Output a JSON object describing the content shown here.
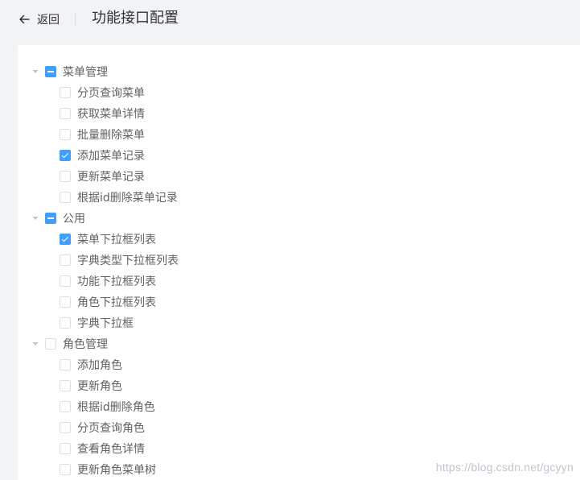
{
  "header": {
    "back_label": "返回",
    "title": "功能接口配置"
  },
  "tree": [
    {
      "label": "菜单管理",
      "state": "indeterminate",
      "expanded": true,
      "children": [
        {
          "label": "分页查询菜单",
          "checked": false
        },
        {
          "label": "获取菜单详情",
          "checked": false
        },
        {
          "label": "批量删除菜单",
          "checked": false
        },
        {
          "label": "添加菜单记录",
          "checked": true
        },
        {
          "label": "更新菜单记录",
          "checked": false
        },
        {
          "label": "根据id删除菜单记录",
          "checked": false
        }
      ]
    },
    {
      "label": "公用",
      "state": "indeterminate",
      "expanded": true,
      "children": [
        {
          "label": "菜单下拉框列表",
          "checked": true
        },
        {
          "label": "字典类型下拉框列表",
          "checked": false
        },
        {
          "label": "功能下拉框列表",
          "checked": false
        },
        {
          "label": "角色下拉框列表",
          "checked": false
        },
        {
          "label": "字典下拉框",
          "checked": false
        }
      ]
    },
    {
      "label": "角色管理",
      "state": "unchecked",
      "expanded": true,
      "children": [
        {
          "label": "添加角色",
          "checked": false
        },
        {
          "label": "更新角色",
          "checked": false
        },
        {
          "label": "根据id删除角色",
          "checked": false
        },
        {
          "label": "分页查询角色",
          "checked": false
        },
        {
          "label": "查看角色详情",
          "checked": false
        },
        {
          "label": "更新角色菜单树",
          "checked": false
        }
      ]
    }
  ],
  "watermark": "https://blog.csdn.net/gcyyn",
  "colors": {
    "accent": "#409eff",
    "text": "#606266",
    "border": "#dcdfe6",
    "background": "#f2f3f5"
  }
}
